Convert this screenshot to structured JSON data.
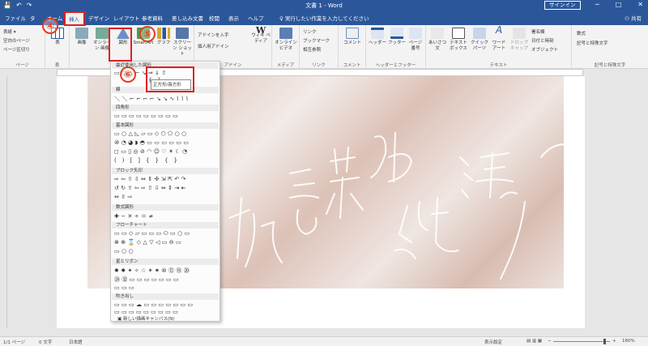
{
  "window": {
    "title": "文書 1 - Word",
    "signin_label": "サインイン",
    "minimize": "─",
    "restore": "□",
    "close": "✕",
    "qat_save": "💾",
    "qat_undo": "↶",
    "qat_redo": "↷"
  },
  "tabs": [
    {
      "label": "ファイル"
    },
    {
      "label": "タ"
    },
    {
      "label": "ホーム"
    },
    {
      "label": "挿入"
    },
    {
      "label": "デザイン"
    },
    {
      "label": "レイアウト"
    },
    {
      "label": "参考資料"
    },
    {
      "label": "差し込み文書"
    },
    {
      "label": "校閲"
    },
    {
      "label": "表示"
    },
    {
      "label": "ヘルプ"
    }
  ],
  "tell_me": "実行したい作業を入力してください",
  "share": "共有",
  "ribbon": {
    "pages_group": {
      "items": [
        "表紙 ▾",
        "空白のページ",
        "ページ区切り"
      ],
      "label": "ページ"
    },
    "table": {
      "label": "表",
      "group": "表"
    },
    "illust": {
      "buttons": [
        "画像",
        "オンライン\n画像",
        "図形",
        "SmartArt",
        "グラフ",
        "スクリーン\nショット"
      ],
      "group": "図"
    },
    "addins": {
      "items": [
        "アドインを入手",
        "個人用アドイン"
      ],
      "wiki": "ウィキ\nペディア",
      "group": "アドイン"
    },
    "media": {
      "button": "オンライン\nビデオ",
      "group": "メディア"
    },
    "links": {
      "items": [
        "リンク",
        "ブックマーク",
        "相互参照"
      ],
      "group": "リンク"
    },
    "comments": {
      "button": "コメント",
      "group": "コメント"
    },
    "hf": {
      "buttons": [
        "ヘッダー",
        "フッター",
        "ページ\n番号"
      ],
      "group": "ヘッダーとフッター"
    },
    "text": {
      "buttons": [
        "あいさつ\n文",
        "テキスト\nボックス",
        "クイック\nパーツ",
        "ワード\nアート",
        "ドロップ\nキャップ"
      ],
      "items": [
        "署名欄",
        "日付と時刻",
        "オブジェクト"
      ],
      "group": "テキスト"
    },
    "symbols": {
      "items": [
        "数式",
        "記号と特殊文字"
      ],
      "group": "記号と特殊文字"
    }
  },
  "shapes_menu": {
    "recent_header": "最近使用した図形",
    "recent_row": "▭○△⌐↘⇒↓⇧",
    "recent_row2": "{ }",
    "sections": [
      {
        "header": "線",
        "rows": [
          "＼＼⌐⌐⌐⌐↘↘∿⌇⌇⌇"
        ]
      },
      {
        "header": "四角形",
        "rows": [
          "▭▭▭▭▭▭▭▭▭"
        ]
      },
      {
        "header": "基本図形",
        "rows": [
          "▭○△◺▱▭◇⬡⬠○○",
          "⑩◔◕◗◓▭▭▭▭▭▭",
          "◻▭▯◎⊘◠☺♡✶☾◔",
          "( ) [ ] { } { }"
        ]
      },
      {
        "header": "ブロック矢印",
        "rows": [
          "⇨⇦⇧⇩⇔⇕✣⇲⇱↶↷",
          "↺↻⇪⇦⇨⇧⇩⇔⇕⇥⇤",
          "⇔⇳⇨"
        ]
      },
      {
        "header": "数式図形",
        "rows": [
          "✚−✕÷＝≠"
        ]
      },
      {
        "header": "フローチャート",
        "rows": [
          "▭▭◇▱▭▭▭⬭▭○▭",
          "⊗⊕⌛◇△▽◁▭⊖▭",
          "▭○○"
        ]
      },
      {
        "header": "星とリボン",
        "rows": [
          "✹✸✦✧☆✶✷⑩⑫⑯⑳",
          "㉔㉜▭▭▭▭▭▭▭",
          "▭▭▭"
        ]
      },
      {
        "header": "吹き出し",
        "rows": [
          "▭▭▭☁▭▭▭▭▭▭▭",
          "▭▭▭▭▭▭▭▭▭"
        ]
      }
    ],
    "new_canvas": "新しい描画キャンバス(N)"
  },
  "tooltip": "正方形/長方形",
  "annotations": {
    "n4": "④",
    "n5": "⑤",
    "n6": "⑥"
  },
  "status": {
    "page": "1/1 ページ",
    "words": "0 文字",
    "lang": "日本語",
    "display_settings": "表示設定",
    "zoom": "160%"
  },
  "colors": {
    "accent": "#2b579a",
    "highlight": "#e02020"
  }
}
